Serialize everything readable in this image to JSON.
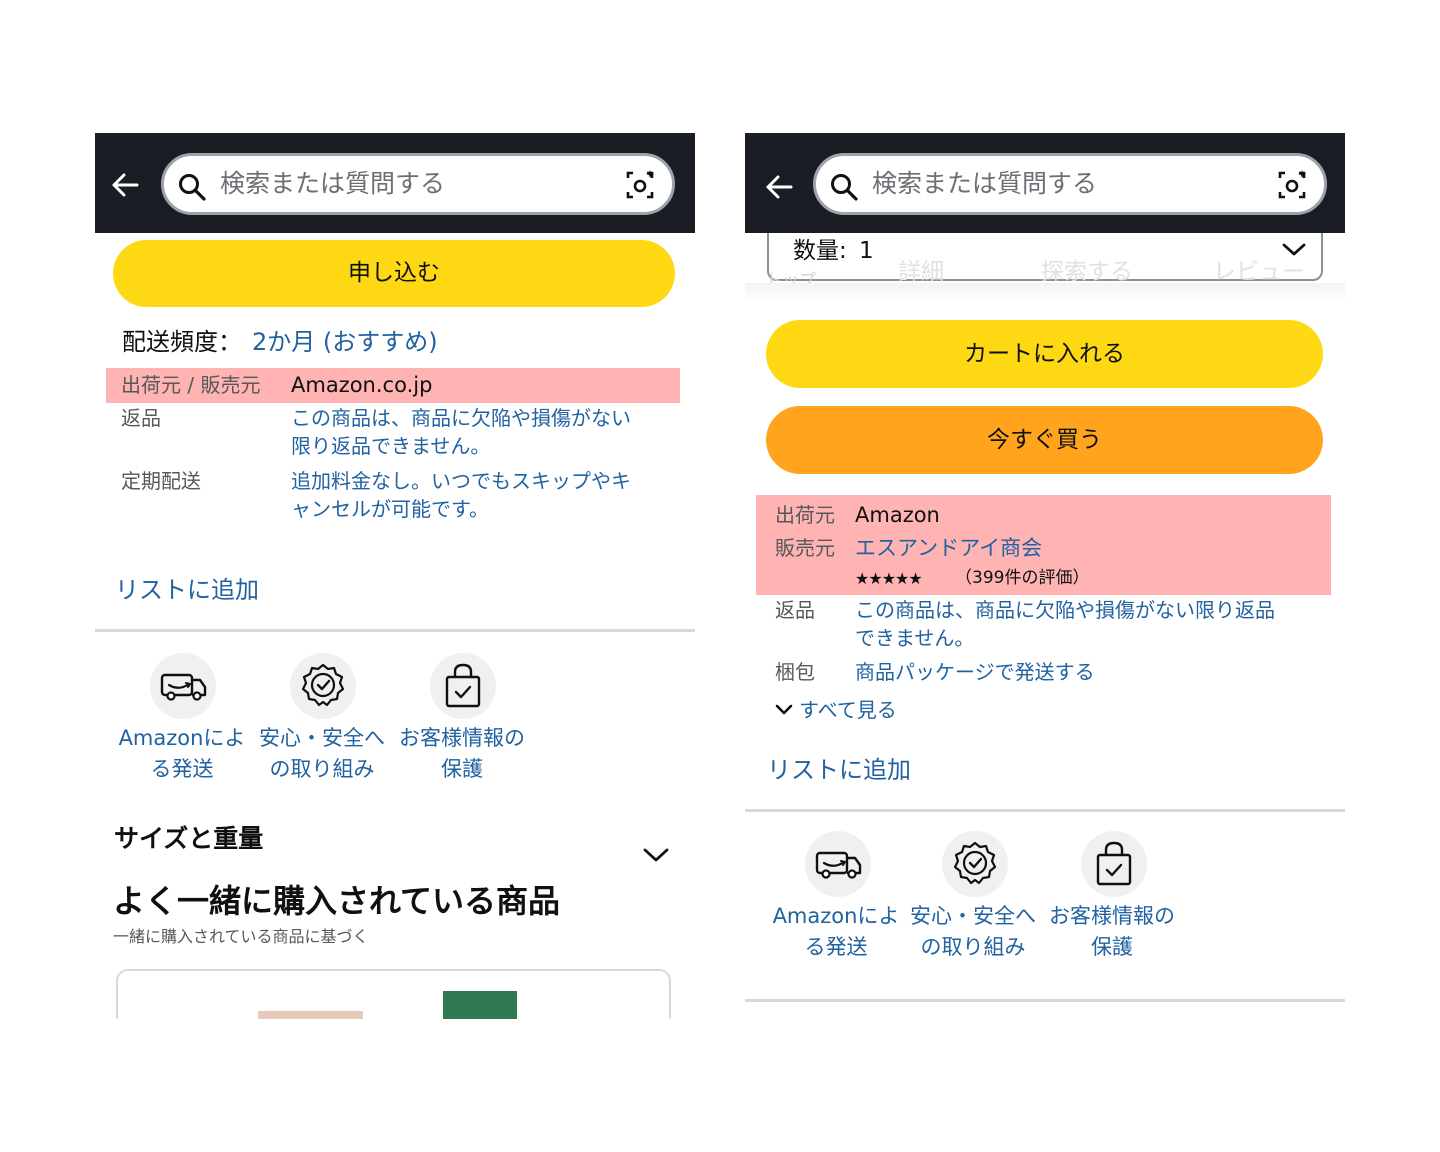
{
  "left": {
    "search": {
      "placeholder": "検索または質問する"
    },
    "icons": {
      "back": "back-arrow-icon",
      "search": "search-icon",
      "camera": "camera-scan-icon"
    },
    "subscribe_button": "申し込む",
    "delivery_frequency": {
      "label": "配送頻度：",
      "value": "2か月 (おすすめ)"
    },
    "details": [
      {
        "label": "出荷元 / 販売元",
        "value": "Amazon.co.jp"
      },
      {
        "label": "返品",
        "value_lines": [
          "この商品は、商品に欠陥や損傷がない",
          "限り返品できません。"
        ]
      },
      {
        "label": "定期配送",
        "value_lines": [
          "追加料金なし。いつでもスキップやキ",
          "ャンセルが可能です。"
        ]
      }
    ],
    "add_to_list": "リストに追加",
    "trust": [
      {
        "icon": "delivery-van-icon",
        "lines": [
          "Amazonによ",
          "る発送"
        ]
      },
      {
        "icon": "verified-badge-icon",
        "lines": [
          "安心・安全へ",
          "の取り組み"
        ]
      },
      {
        "icon": "shopping-bag-check-icon",
        "lines": [
          "お客様情報の",
          "保護"
        ]
      }
    ],
    "size_weight": "サイズと重量",
    "frequently_bought": {
      "title": "よく一緒に購入されている商品",
      "subtitle": "一緒に購入されている商品に基づく"
    }
  },
  "right": {
    "search": {
      "placeholder": "検索または質問する"
    },
    "quantity": {
      "label": "数量:",
      "value": "1"
    },
    "faded_tabs": [
      "トップ",
      "詳細",
      "探索する",
      "レビュー"
    ],
    "cart_button": "カートに入れる",
    "buy_now_button": "今すぐ買う",
    "shipper": {
      "label": "出荷元",
      "value": "Amazon"
    },
    "seller": {
      "label": "販売元",
      "value": "エスアンドアイ商会",
      "stars": "★★★★★",
      "ratings": "（399件の評価）"
    },
    "returns": {
      "label": "返品",
      "value_lines": [
        "この商品は、商品に欠陥や損傷がない限り返品",
        "できません。"
      ]
    },
    "packaging": {
      "label": "梱包",
      "value": "商品パッケージで発送する"
    },
    "see_all": "すべて見る",
    "add_to_list": "リストに追加",
    "trust": [
      {
        "icon": "delivery-van-icon",
        "lines": [
          "Amazonによ",
          "る発送"
        ]
      },
      {
        "icon": "verified-badge-icon",
        "lines": [
          "安心・安全へ",
          "の取り組み"
        ]
      },
      {
        "icon": "shopping-bag-check-icon",
        "lines": [
          "お客様情報の",
          "保護"
        ]
      }
    ]
  },
  "colors": {
    "topbar": "#1a1e24",
    "yellow_button": "#ffd814",
    "orange_button": "#ffa41c",
    "link": "#2162a1",
    "highlight": "#ffb3b3"
  }
}
